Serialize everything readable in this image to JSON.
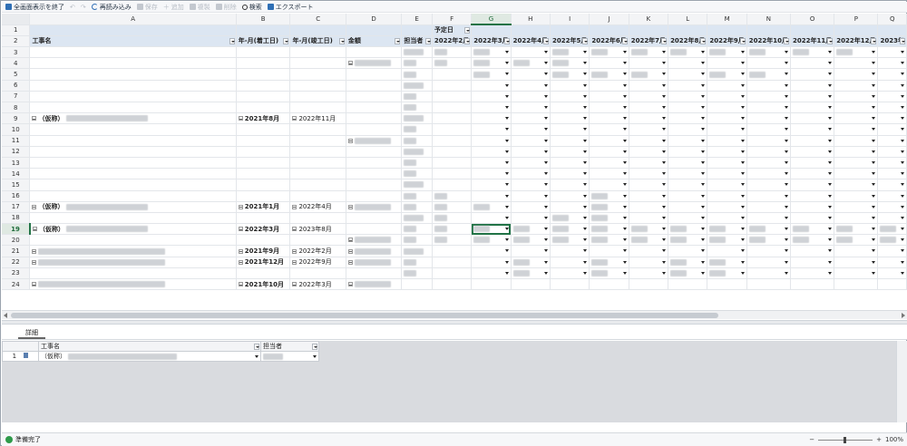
{
  "toolbar": {
    "exit_fullscreen": "全画面表示を終了",
    "reload": "再読み込み",
    "save": "保存",
    "add": "追加",
    "copy": "複製",
    "delete": "削除",
    "search": "検索",
    "export": "エクスポート"
  },
  "columns": [
    "A",
    "B",
    "C",
    "D",
    "E",
    "F",
    "G",
    "H",
    "I",
    "J",
    "K",
    "L",
    "M",
    "N",
    "O",
    "P",
    "Q"
  ],
  "selected_column": "G",
  "selected_row": "19",
  "header_row1": {
    "planned_date_label": "予定日"
  },
  "header_row2": {
    "project_name": "工事名",
    "start_month": "年-月(着工日)",
    "end_month": "年-月(竣工日)",
    "amount": "金額",
    "person": "担当者",
    "months": [
      "2022年2月",
      "2022年3月",
      "2022年4月",
      "2022年5月",
      "2022年6月",
      "2022年7月",
      "2022年8月",
      "2022年9月",
      "2022年10月",
      "2022年11月",
      "2022年12月",
      "2023年"
    ]
  },
  "row_numbers": [
    "1",
    "2",
    "3",
    "4",
    "5",
    "6",
    "7",
    "8",
    "9",
    "10",
    "11",
    "12",
    "13",
    "14",
    "15",
    "16",
    "17",
    "18",
    "19",
    "20",
    "21",
    "22",
    "23",
    "24"
  ],
  "groups": [
    {
      "name_prefix": "（仮称）",
      "start": "2021年8月",
      "end": "2022年11月"
    },
    {
      "name_prefix": "（仮称）",
      "start": "2021年1月",
      "end": "2022年4月"
    },
    {
      "name_prefix": "（仮称）",
      "start": "2022年3月",
      "end": "2023年8月"
    },
    {
      "name_prefix": "",
      "start": "2021年9月",
      "end": "2022年2月"
    },
    {
      "name_prefix": "",
      "start": "2021年12月",
      "end": "2022年9月"
    },
    {
      "name_prefix": "",
      "start": "2021年10月",
      "end": "2022年3月"
    }
  ],
  "detail": {
    "tab_label": "詳細",
    "col_project": "工事名",
    "col_person": "担当者",
    "row_number": "1",
    "row_project_value": "（仮称）"
  },
  "status": {
    "text": "準備完了",
    "zoom": "100%"
  }
}
